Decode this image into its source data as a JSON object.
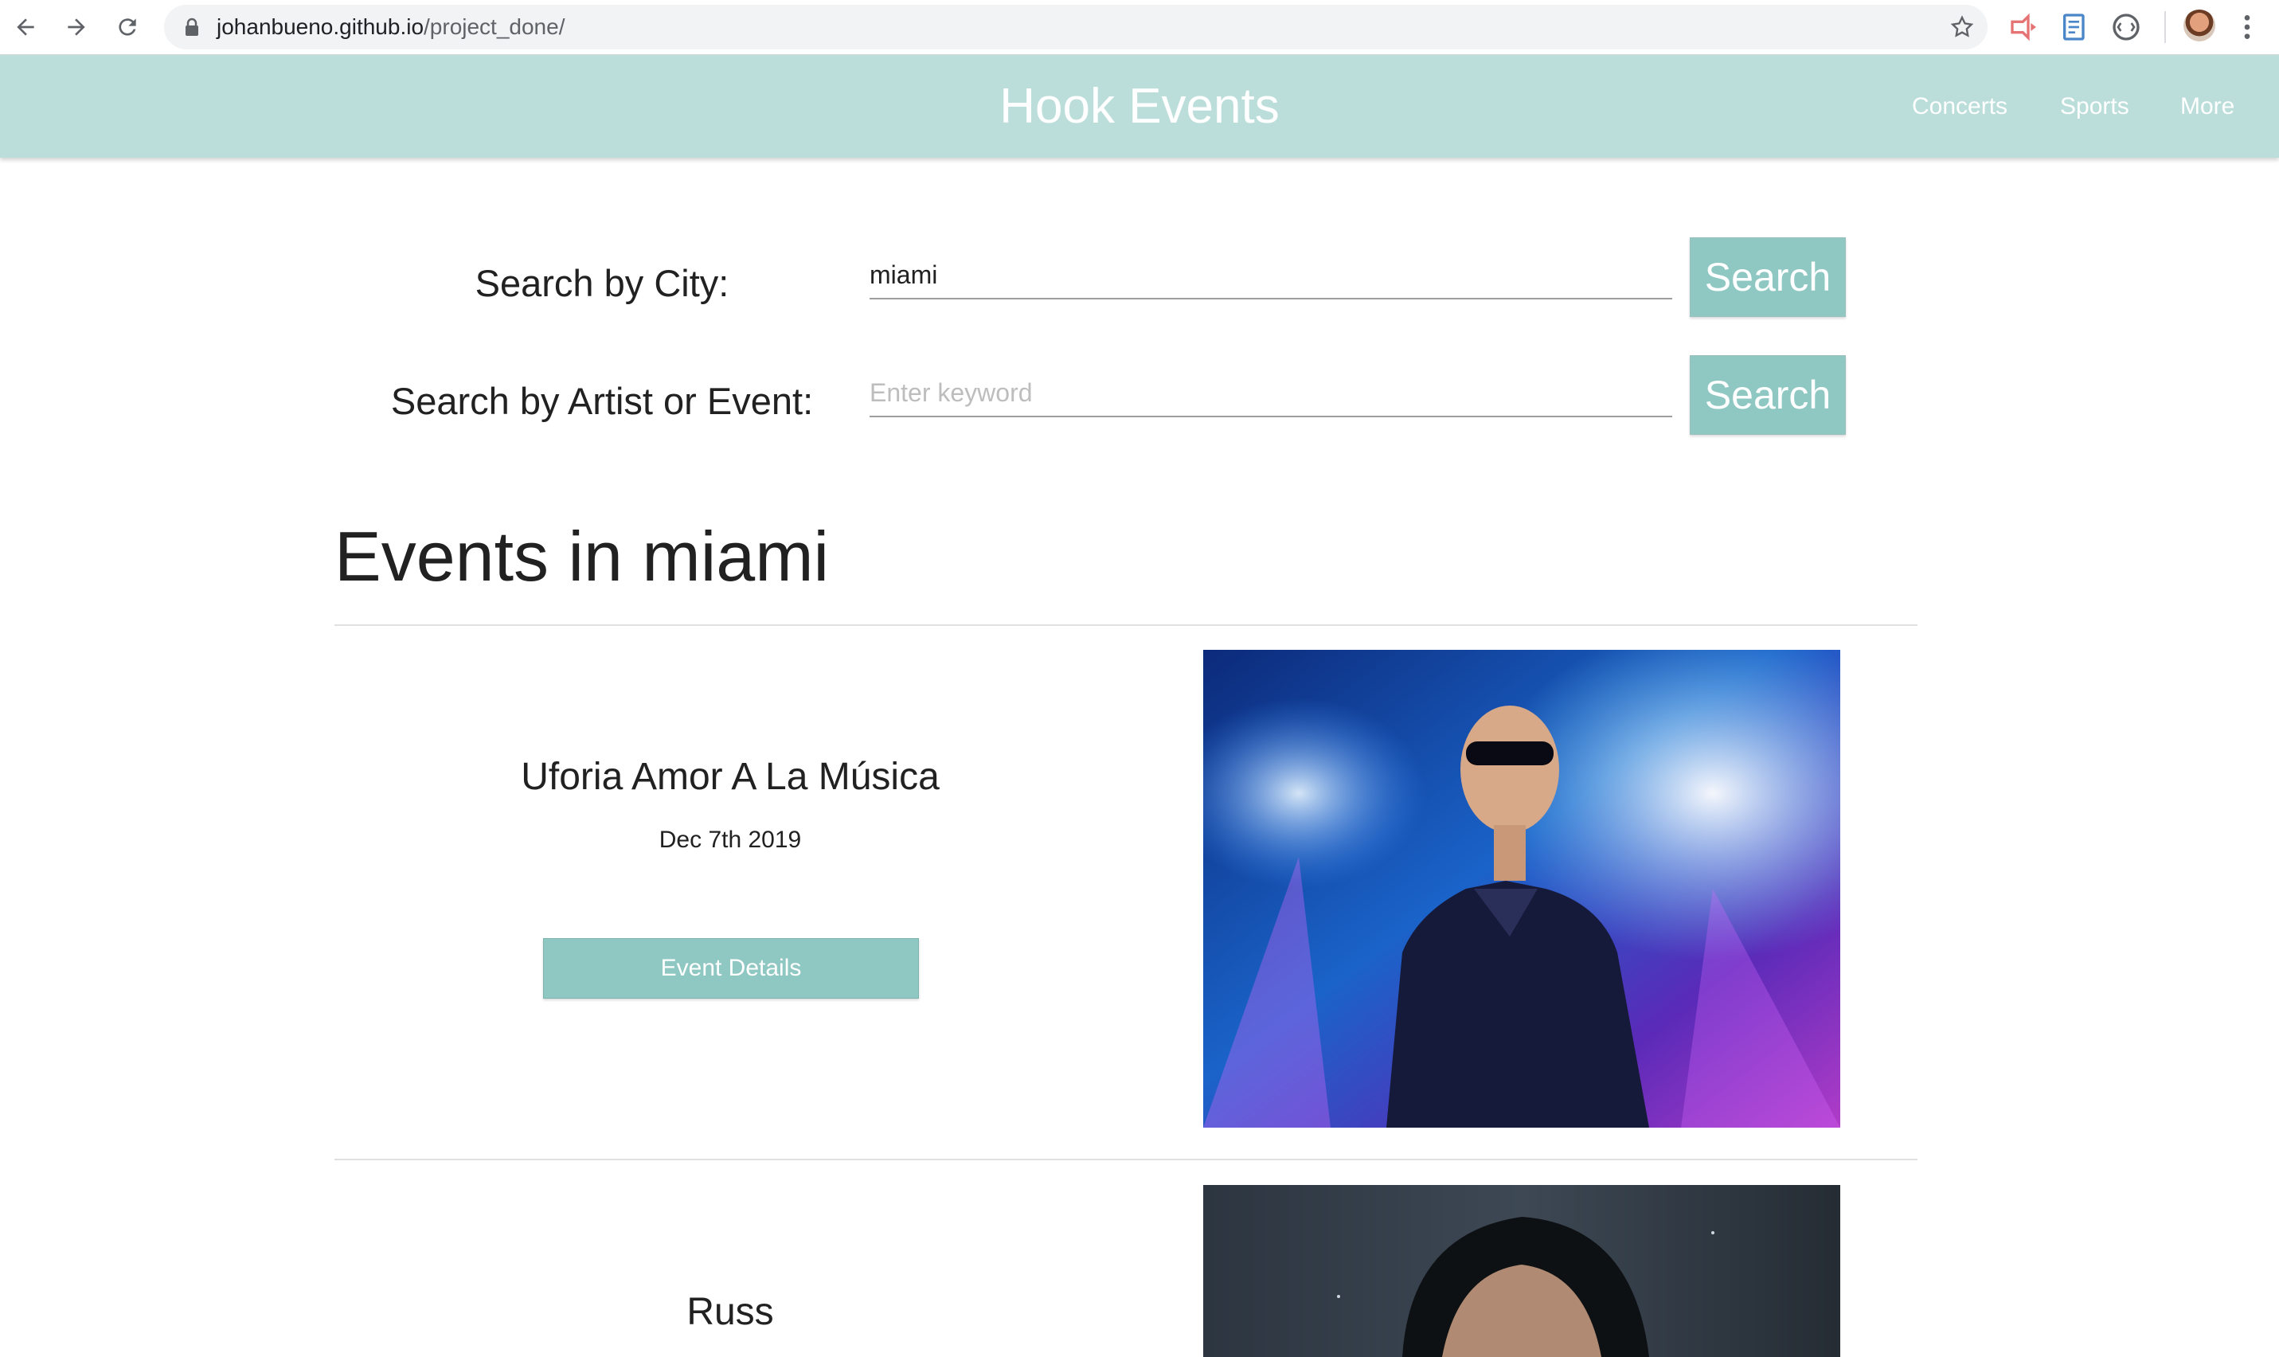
{
  "browser": {
    "url_host": "johanbueno.github.io",
    "url_path": "/project_done/"
  },
  "header": {
    "brand": "Hook Events",
    "nav": [
      {
        "label": "Concerts"
      },
      {
        "label": "Sports"
      },
      {
        "label": "More"
      }
    ]
  },
  "search": {
    "city_label": "Search by City:",
    "city_value": "miami",
    "city_button": "Search",
    "keyword_label": "Search by Artist or Event:",
    "keyword_placeholder": "Enter keyword",
    "keyword_value": "",
    "keyword_button": "Search"
  },
  "results": {
    "heading": "Events in miami",
    "events": [
      {
        "title": "Uforia Amor A La Música",
        "date": "Dec 7th 2019",
        "button": "Event Details"
      },
      {
        "title": "Russ"
      }
    ]
  },
  "colors": {
    "header_bg": "#bcdeda",
    "button_bg": "#8fc8c2"
  },
  "icons": [
    "back-arrow-icon",
    "forward-arrow-icon",
    "reload-icon",
    "lock-icon",
    "star-icon",
    "extension-icon",
    "profile-avatar",
    "more-vertical-icon"
  ]
}
